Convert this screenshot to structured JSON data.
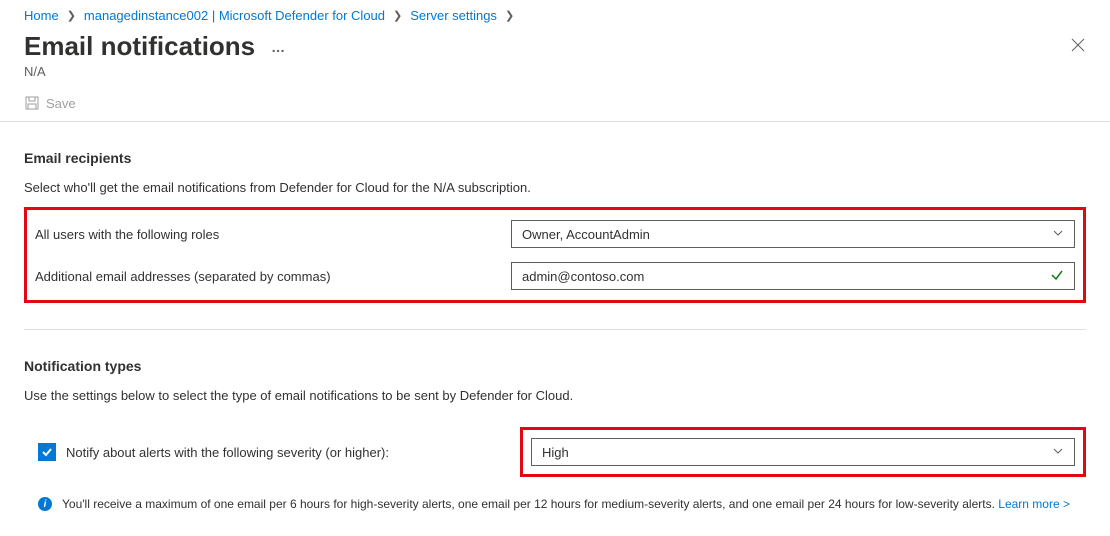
{
  "breadcrumb": {
    "home": "Home",
    "instance": "managedinstance002 | Microsoft Defender for Cloud",
    "server_settings": "Server settings"
  },
  "header": {
    "title": "Email notifications",
    "subtitle": "N/A"
  },
  "toolbar": {
    "save_label": "Save"
  },
  "recipients": {
    "title": "Email recipients",
    "description": "Select who'll get the email notifications from Defender for Cloud for the N/A subscription.",
    "roles_label": "All users with the following roles",
    "roles_value": "Owner, AccountAdmin",
    "emails_label": "Additional email addresses (separated by commas)",
    "emails_value": "admin@contoso.com"
  },
  "notifications": {
    "title": "Notification types",
    "description": "Use the settings below to select the type of email notifications to be sent by Defender for Cloud.",
    "severity_checkbox_label": "Notify about alerts with the following severity (or higher):",
    "severity_value": "High",
    "info_text": "You'll receive a maximum of one email per 6 hours for high-severity alerts, one email per 12 hours for medium-severity alerts, and one email per 24 hours for low-severity alerts.",
    "learn_more": "Learn more >"
  }
}
